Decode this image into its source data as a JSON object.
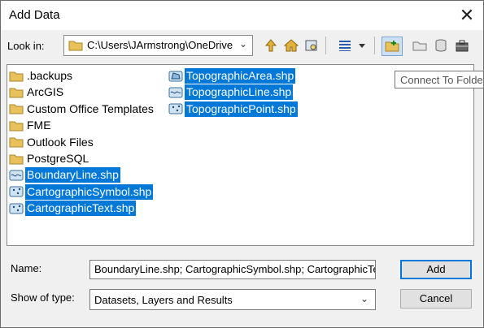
{
  "dialog": {
    "title": "Add Data"
  },
  "lookin": {
    "label": "Look in:",
    "path": "C:\\Users\\JArmstrong\\OneDrive"
  },
  "toolbar": {
    "tooltip": "Connect To Folder"
  },
  "files": [
    {
      "name": ".backups",
      "type": "folder",
      "selected": false
    },
    {
      "name": "ArcGIS",
      "type": "folder",
      "selected": false
    },
    {
      "name": "Custom Office Templates",
      "type": "folder",
      "selected": false
    },
    {
      "name": "FME",
      "type": "folder",
      "selected": false
    },
    {
      "name": "Outlook Files",
      "type": "folder",
      "selected": false
    },
    {
      "name": "PostgreSQL",
      "type": "folder",
      "selected": false
    },
    {
      "name": "BoundaryLine.shp",
      "type": "line-shapefile",
      "selected": true
    },
    {
      "name": "CartographicSymbol.shp",
      "type": "point-shapefile",
      "selected": true
    },
    {
      "name": "CartographicText.shp",
      "type": "point-shapefile",
      "selected": true
    },
    {
      "name": "TopographicArea.shp",
      "type": "polygon-shapefile",
      "selected": true
    },
    {
      "name": "TopographicLine.shp",
      "type": "line-shapefile",
      "selected": true
    },
    {
      "name": "TopographicPoint.shp",
      "type": "point-shapefile",
      "selected": true
    }
  ],
  "name_field": {
    "label": "Name:",
    "value": "BoundaryLine.shp; CartographicSymbol.shp; CartographicText.shp; TopographicArea.shp"
  },
  "type_field": {
    "label": "Show of type:",
    "value": "Datasets, Layers and Results"
  },
  "buttons": {
    "add": "Add",
    "cancel": "Cancel"
  }
}
